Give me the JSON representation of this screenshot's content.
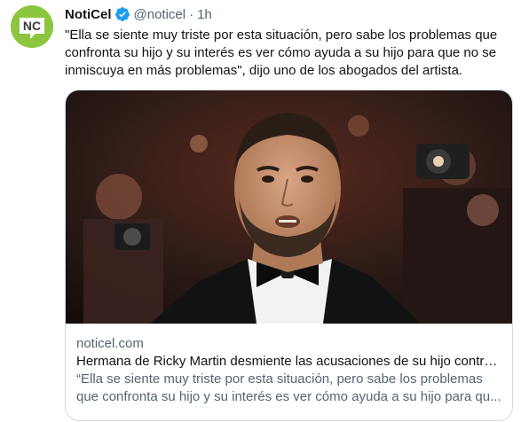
{
  "author": {
    "name": "NotiCel",
    "handle": "@noticel",
    "time": "1h",
    "avatar_text": "NC",
    "verified": true,
    "brand_color": "#8cc63f",
    "verified_color": "#1d9bf0"
  },
  "tweet": {
    "text": "\"Ella se siente muy triste por esta situación, pero sabe los problemas que confronta su hijo y su interés es ver cómo ayuda a su hijo para que no se inmiscuya en más problemas\", dijo uno de los abogados del artista."
  },
  "card": {
    "domain": "noticel.com",
    "title": "Hermana de Ricky Martin desmiente las acusaciones de su hijo contra...",
    "description": "“Ella se siente muy triste por esta situación, pero sabe los problemas que confronta su hijo y su interés es ver cómo ayuda a su hijo para qu..."
  }
}
